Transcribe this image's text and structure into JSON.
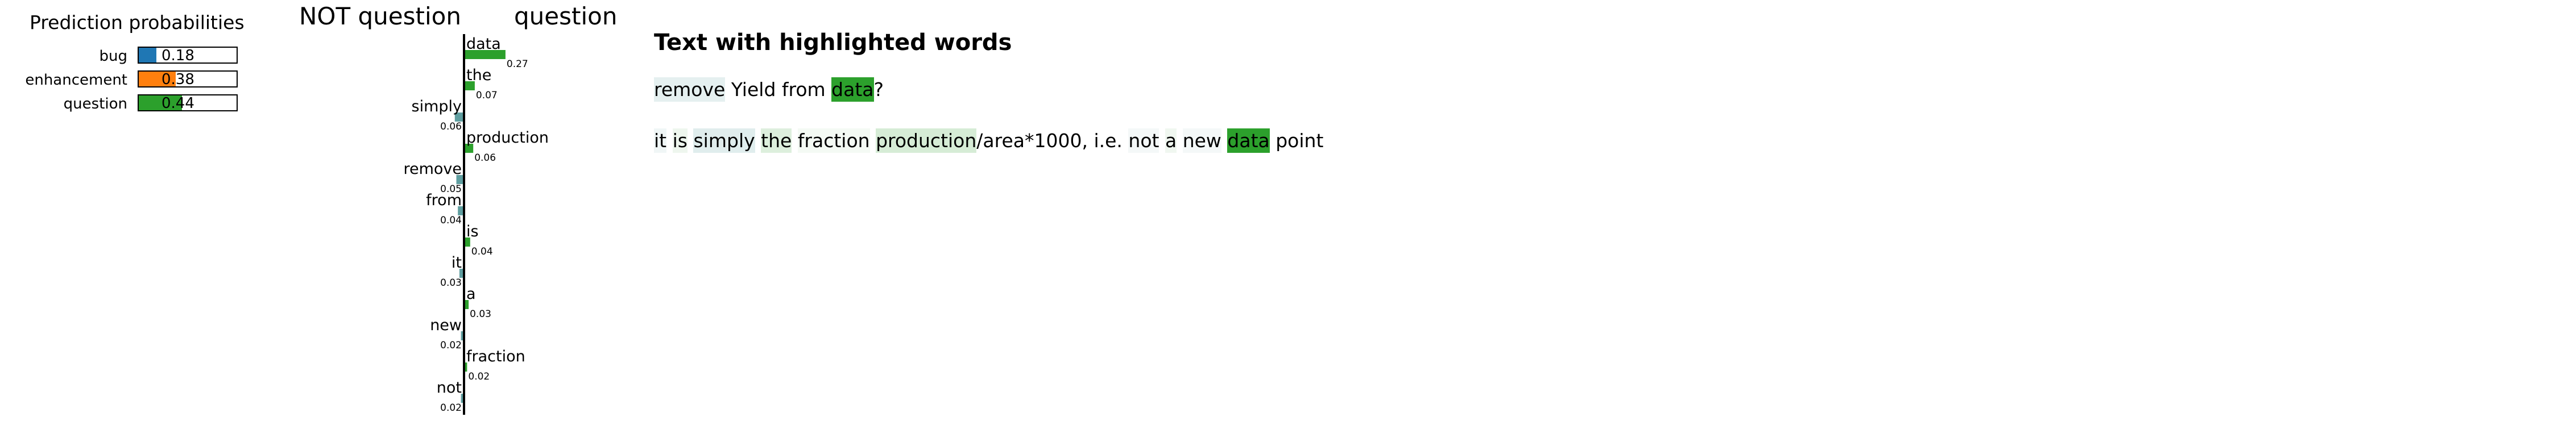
{
  "prediction": {
    "title": "Prediction probabilities",
    "classes": [
      {
        "label": "bug",
        "value": 0.18,
        "display": "0.18",
        "color": "#1f77b4"
      },
      {
        "label": "enhancement",
        "value": 0.38,
        "display": "0.38",
        "color": "#ff7f0e"
      },
      {
        "label": "question",
        "value": 0.44,
        "display": "0.44",
        "color": "#2ca02c"
      }
    ]
  },
  "chart_data": {
    "type": "bar",
    "negative_label": "NOT question",
    "positive_label": "question",
    "negative_color": "#5f9ea0",
    "positive_color": "#2ca02c",
    "features": [
      {
        "word": "data",
        "value": 0.27,
        "display": "0.27",
        "side": "positive"
      },
      {
        "word": "the",
        "value": 0.07,
        "display": "0.07",
        "side": "positive"
      },
      {
        "word": "simply",
        "value": 0.06,
        "display": "0.06",
        "side": "negative"
      },
      {
        "word": "production",
        "value": 0.06,
        "display": "0.06",
        "side": "positive"
      },
      {
        "word": "remove",
        "value": 0.05,
        "display": "0.05",
        "side": "negative"
      },
      {
        "word": "from",
        "value": 0.04,
        "display": "0.04",
        "side": "negative"
      },
      {
        "word": "is",
        "value": 0.04,
        "display": "0.04",
        "side": "positive"
      },
      {
        "word": "it",
        "value": 0.03,
        "display": "0.03",
        "side": "negative"
      },
      {
        "word": "a",
        "value": 0.03,
        "display": "0.03",
        "side": "positive"
      },
      {
        "word": "new",
        "value": 0.02,
        "display": "0.02",
        "side": "negative"
      },
      {
        "word": "fraction",
        "value": 0.02,
        "display": "0.02",
        "side": "positive"
      },
      {
        "word": "not",
        "value": 0.02,
        "display": "0.02",
        "side": "negative"
      }
    ]
  },
  "highlighted": {
    "title": "Text with highlighted words",
    "lines": [
      [
        {
          "text": "remove",
          "bg": "#e5f0f0"
        },
        {
          "text": " Yield from ",
          "bg": ""
        },
        {
          "text": "data",
          "bg": "#2ca02c"
        },
        {
          "text": "?",
          "bg": ""
        }
      ],
      [
        {
          "text": "it",
          "bg": "#f0f6f6"
        },
        {
          "text": " ",
          "bg": ""
        },
        {
          "text": "is",
          "bg": "#eef6ee"
        },
        {
          "text": " ",
          "bg": ""
        },
        {
          "text": "simply",
          "bg": "#e0eded"
        },
        {
          "text": " ",
          "bg": ""
        },
        {
          "text": "the",
          "bg": "#ddefdd"
        },
        {
          "text": " ",
          "bg": ""
        },
        {
          "text": "fraction",
          "bg": "#f4faf4"
        },
        {
          "text": " ",
          "bg": ""
        },
        {
          "text": "production",
          "bg": "#d6ecd6"
        },
        {
          "text": "/area*1000, i.e. ",
          "bg": ""
        },
        {
          "text": "not",
          "bg": "#f4f8f8"
        },
        {
          "text": " ",
          "bg": ""
        },
        {
          "text": "a",
          "bg": "#f0f7f0"
        },
        {
          "text": " ",
          "bg": ""
        },
        {
          "text": "new",
          "bg": "#f4f8f8"
        },
        {
          "text": " ",
          "bg": ""
        },
        {
          "text": "data",
          "bg": "#2ca02c"
        },
        {
          "text": " point",
          "bg": ""
        }
      ]
    ]
  }
}
